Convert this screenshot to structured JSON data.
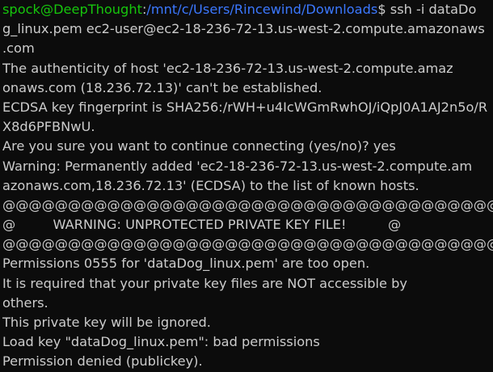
{
  "prompt": {
    "user_host": "spock@DeepThought",
    "separator": ":",
    "path": "/mnt/c/Users/Rincewind/Downloads",
    "symbol": "$",
    "command_part1": " ssh -i dataDo"
  },
  "lines": [
    "g_linux.pem ec2-user@ec2-18-236-72-13.us-west-2.compute.amazonaws",
    ".com",
    "The authenticity of host 'ec2-18-236-72-13.us-west-2.compute.amaz",
    "onaws.com (18.236.72.13)' can't be established.",
    "ECDSA key fingerprint is SHA256:/rWH+u4IcWGmRwhOJ/iQpJ0A1AJ2n5o/R",
    "X8d6PFBNwU.",
    "Are you sure you want to continue connecting (yes/no)? yes",
    "Warning: Permanently added 'ec2-18-236-72-13.us-west-2.compute.am",
    "azonaws.com,18.236.72.13' (ECDSA) to the list of known hosts.",
    "@@@@@@@@@@@@@@@@@@@@@@@@@@@@@@@@@@@@@@@@@@@@@@@@@@@@@@@@@@@",
    "@         WARNING: UNPROTECTED PRIVATE KEY FILE!          @",
    "@@@@@@@@@@@@@@@@@@@@@@@@@@@@@@@@@@@@@@@@@@@@@@@@@@@@@@@@@@@",
    "Permissions 0555 for 'dataDog_linux.pem' are too open.",
    "It is required that your private key files are NOT accessible by",
    "others.",
    "This private key will be ignored.",
    "Load key \"dataDog_linux.pem\": bad permissions",
    "Permission denied (publickey)."
  ],
  "colors": {
    "background": "#0c0c0c",
    "text": "#cccccc",
    "user_host": "#16c60c",
    "path": "#3b78ff"
  }
}
